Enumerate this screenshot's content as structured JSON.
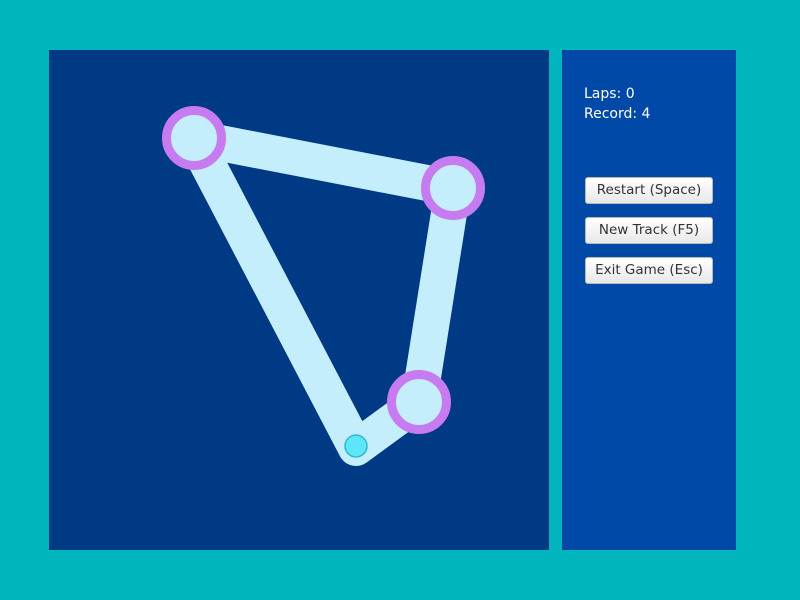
{
  "hud": {
    "laps_label": "Laps:",
    "laps_value": "0",
    "record_label": "Record:",
    "record_value": "4"
  },
  "buttons": {
    "restart_label": "Restart (Space)",
    "new_track_label": "New Track (F5)",
    "exit_label": "Exit Game (Esc)"
  },
  "colors": {
    "background": "#00b5bd",
    "playfield": "#013a84",
    "panel": "#0049a7",
    "track": "#c4eefb",
    "checkpoint_ring": "#c77bf0",
    "checkpoint_fill": "#c4eefb",
    "ball": "#5ce6f7",
    "ball_outline": "#33b7cc"
  }
}
